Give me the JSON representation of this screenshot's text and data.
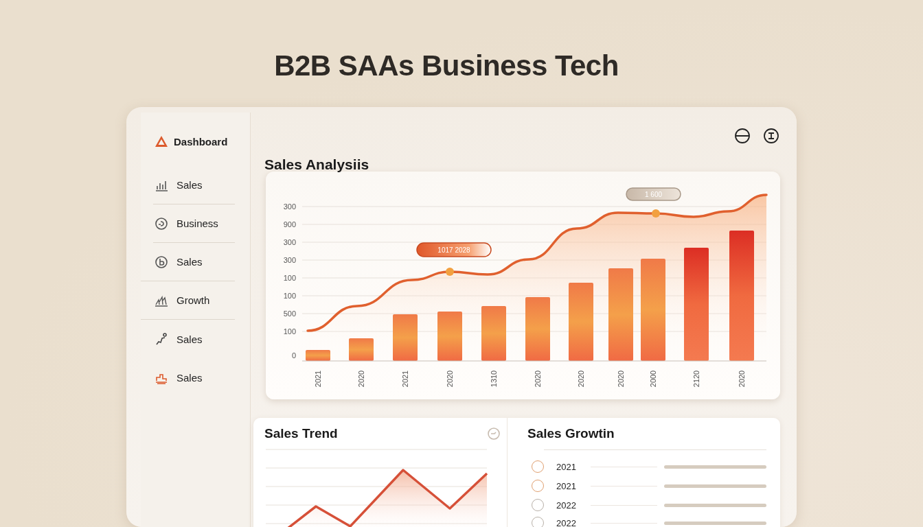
{
  "page_title": "B2B SAAs Business Tech",
  "sidebar": {
    "items": [
      {
        "label": "Dashboard"
      },
      {
        "label": "Sales"
      },
      {
        "label": "Business"
      },
      {
        "label": "Sales"
      },
      {
        "label": "Growth"
      },
      {
        "label": "Sales"
      },
      {
        "label": "Sales"
      }
    ]
  },
  "sales_analysis": {
    "title": "Sales Analysiis",
    "y_labels": [
      "300",
      "900",
      "300",
      "300",
      "100",
      "100",
      "500",
      "100",
      "0"
    ],
    "x_labels": [
      "2021",
      "2020",
      "2021",
      "2020",
      "1310",
      "2020",
      "2020",
      "2020",
      "2000",
      "2120",
      "2020"
    ],
    "tooltips": [
      {
        "text": "1017 2028",
        "kind": "accent"
      },
      {
        "text": "1 600",
        "kind": "muted"
      }
    ]
  },
  "sales_trend": {
    "title": "Sales Trend"
  },
  "sales_growth": {
    "title": "Sales Growtin",
    "rows": [
      {
        "year": "2021",
        "color": "#e0a070"
      },
      {
        "year": "2021",
        "color": "#e0a070"
      },
      {
        "year": "2022",
        "color": "#b8b0a8"
      },
      {
        "year": "2022",
        "color": "#b8b0a8"
      }
    ]
  }
}
